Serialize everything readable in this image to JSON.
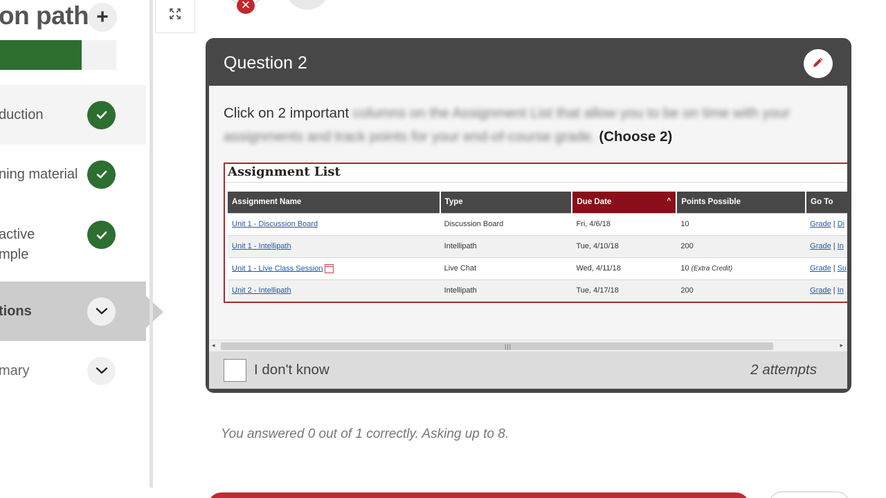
{
  "sidebar": {
    "title": "on path",
    "plus_label": "+",
    "progress_percent": 70,
    "items": [
      {
        "label": "duction",
        "status": "complete"
      },
      {
        "label": "ning material",
        "status": "complete"
      },
      {
        "label": "active",
        "label_line2": "mple",
        "status": "complete"
      },
      {
        "label": "tions",
        "status": "current"
      },
      {
        "label": "mary",
        "status": "collapsed"
      }
    ]
  },
  "icons": {
    "expand": "expand-icon",
    "edit": "pencil-icon",
    "check": "check-icon",
    "chevron": "chevron-down-icon",
    "close": "close-icon"
  },
  "colors": {
    "success_green": "#2d6e31",
    "card_header": "#474747",
    "brand_red": "#c12a30",
    "due_date_header": "#8a0f1a"
  },
  "top": {
    "close_glyph": "✕"
  },
  "question": {
    "title": "Question 2",
    "prompt_visible": "Click on 2 important",
    "prompt_blurred_1": "columns on the Assignment List that allow you to be on time with your",
    "prompt_blurred_2": "assignments and track points for your end-of-course grade.",
    "prompt_choose": "(Choose 2)",
    "assignment_list": {
      "title": "Assignment List",
      "columns": [
        "Assignment Name",
        "Type",
        "Due Date",
        "Points Possible",
        "Go To"
      ],
      "sort_indicator": "^",
      "rows": [
        {
          "name": "Unit 1 - Discussion Board",
          "type": "Discussion Board",
          "due": "Fri, 4/6/18",
          "points": "10",
          "extra": "",
          "goto_1": "Grade",
          "goto_2": "Di"
        },
        {
          "name": "Unit 1 - Intellipath",
          "type": "Intellipath",
          "due": "Tue, 4/10/18",
          "points": "200",
          "extra": "",
          "goto_1": "Grade",
          "goto_2": "In"
        },
        {
          "name": "Unit 1 - Live Class Session",
          "type": "Live Chat",
          "due": "Wed, 4/11/18",
          "points": "10",
          "extra": "(Extra Credit)",
          "goto_1": "Grade",
          "goto_2": "Su"
        },
        {
          "name": "Unit 2 - Intellipath",
          "type": "Intellipath",
          "due": "Tue, 4/17/18",
          "points": "200",
          "extra": "",
          "goto_1": "Grade",
          "goto_2": "In"
        }
      ]
    },
    "scrollbar": {
      "left_arrow": "◂",
      "right_arrow": "▸",
      "grip": "|||"
    },
    "dont_know_label": "I don't know",
    "attempts": "2 attempts"
  },
  "status_text": "You answered 0 out of 1 correctly. Asking up to 8."
}
